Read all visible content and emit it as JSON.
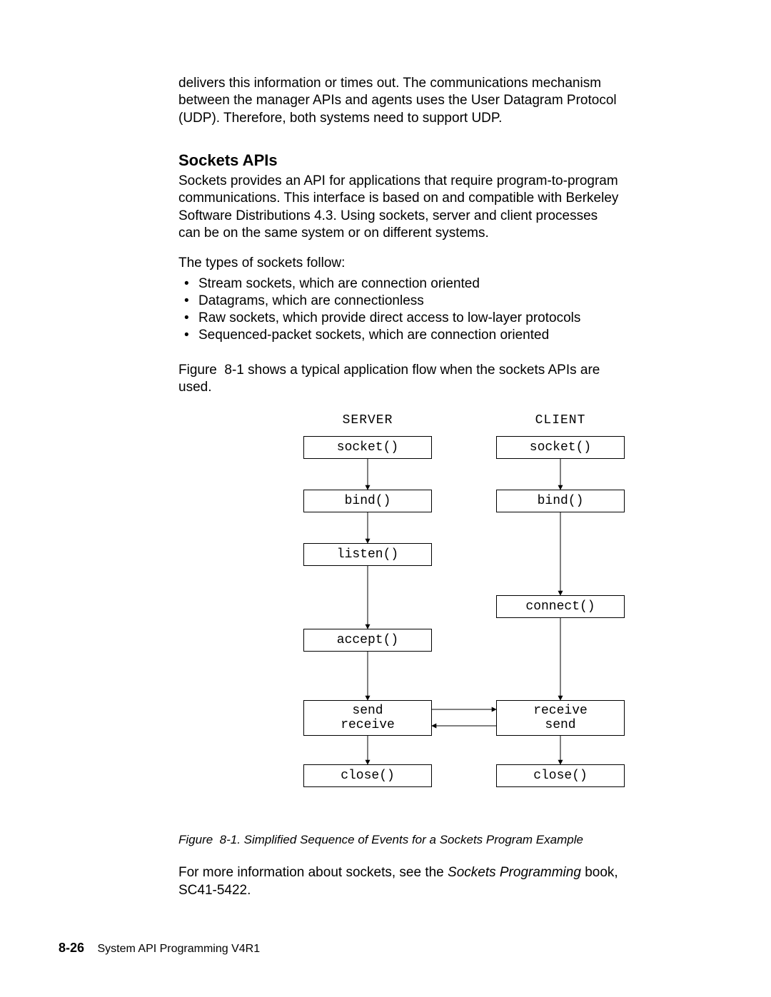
{
  "intro_para": "delivers this information or times out.  The communications mechanism between the manager APIs and agents uses the User Datagram Protocol (UDP).  Therefore, both systems need to support UDP.",
  "section_heading": "Sockets APIs",
  "para1": "Sockets provides an API for applications that require program-to-program communications.  This interface is based on and compatible with Berkeley Software Distributions 4.3.  Using sockets, server and client processes can be on the same system or on different systems.",
  "para2": "The types of sockets follow:",
  "list": {
    "i0": "Stream sockets, which are connection oriented",
    "i1": "Datagrams, which are connectionless",
    "i2": "Raw sockets, which provide direct access to low-layer protocols",
    "i3": "Sequenced-packet sockets, which are connection oriented"
  },
  "para3": "Figure  8-1 shows a typical application flow when the sockets APIs are used.",
  "diagram": {
    "server_title": "SERVER",
    "client_title": "CLIENT",
    "server": {
      "b0": "socket()",
      "b1": "bind()",
      "b2": "listen()",
      "b3": "accept()",
      "b4a": "send",
      "b4b": "receive",
      "b5": "close()"
    },
    "client": {
      "b0": "socket()",
      "b1": "bind()",
      "b2": "connect()",
      "b3a": "receive",
      "b3b": "send",
      "b4": "close()"
    }
  },
  "figure_caption": "Figure   8-1.  Simplified Sequence of Events for a Sockets Program Example",
  "closing_pre": "For more information about sockets, see the ",
  "closing_em": "Sockets Programming",
  "closing_post": " book, SC41-5422.",
  "footer": {
    "page": "8-26",
    "title": "System API Programming V4R1"
  }
}
